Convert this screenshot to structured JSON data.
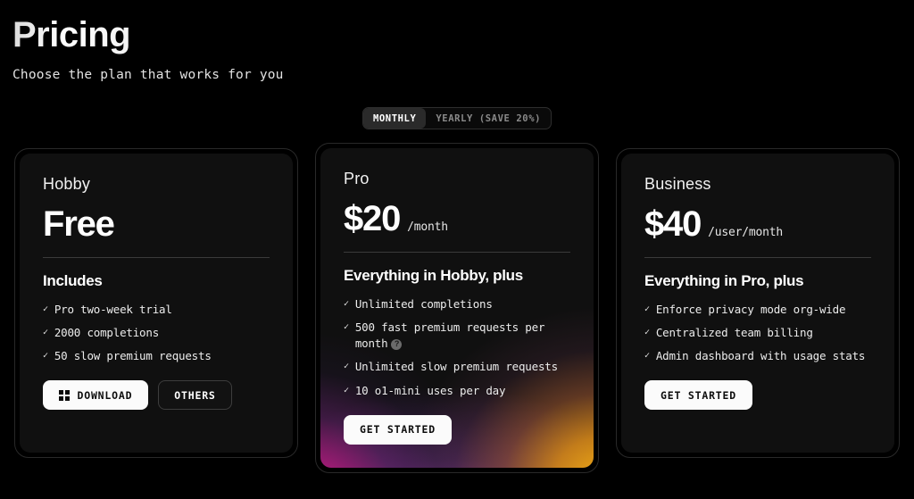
{
  "header": {
    "title": "Pricing",
    "subtitle": "Choose the plan that works for you"
  },
  "billing_toggle": {
    "monthly_label": "MONTHLY",
    "yearly_label": "YEARLY (SAVE 20%)",
    "selected": "MONTHLY"
  },
  "plans": [
    {
      "name": "Hobby",
      "price": "Free",
      "price_unit": "",
      "features_heading": "Includes",
      "features": [
        {
          "text": "Pro two-week trial",
          "info": false
        },
        {
          "text": "2000 completions",
          "info": false
        },
        {
          "text": "50 slow premium requests",
          "info": false
        }
      ],
      "buttons": [
        {
          "label": "DOWNLOAD",
          "style": "light",
          "icon": "windows-icon"
        },
        {
          "label": "OTHERS",
          "style": "dark",
          "icon": ""
        }
      ],
      "featured": false
    },
    {
      "name": "Pro",
      "price": "$20",
      "price_unit": "/month",
      "features_heading": "Everything in Hobby, plus",
      "features": [
        {
          "text": "Unlimited completions",
          "info": false
        },
        {
          "text": "500 fast premium requests per month",
          "info": true
        },
        {
          "text": "Unlimited slow premium requests",
          "info": false
        },
        {
          "text": "10 o1-mini uses per day",
          "info": false
        }
      ],
      "buttons": [
        {
          "label": "GET STARTED",
          "style": "light",
          "icon": ""
        }
      ],
      "featured": true
    },
    {
      "name": "Business",
      "price": "$40",
      "price_unit": "/user/month",
      "features_heading": "Everything in Pro, plus",
      "features": [
        {
          "text": "Enforce privacy mode org-wide",
          "info": false
        },
        {
          "text": "Centralized team billing",
          "info": false
        },
        {
          "text": "Admin dashboard with usage stats",
          "info": false
        }
      ],
      "buttons": [
        {
          "label": "GET STARTED",
          "style": "light",
          "icon": ""
        }
      ],
      "featured": false
    }
  ],
  "icons": {
    "check": "✓",
    "info": "?"
  },
  "colors": {
    "background": "#000000",
    "card_background": "#101010",
    "card_border": "#292929",
    "text_primary": "#ffffff",
    "text_muted": "#8a8a8a",
    "gradient_pink": "#d61880",
    "gradient_purple": "#a846be",
    "gradient_orange": "#f6b014"
  }
}
